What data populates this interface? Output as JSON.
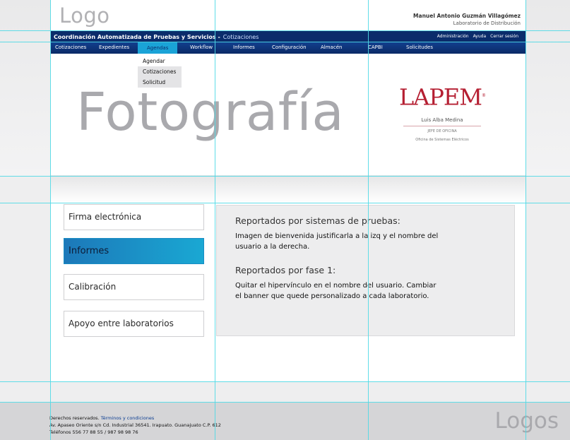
{
  "header": {
    "logo": "Logo",
    "user": {
      "name": "Manuel Antonio Guzmán Villagómez",
      "lab": "Laboratorio de Distribución"
    }
  },
  "titlebar": {
    "app_title": "Coordinación Automatizada de Pruebas y Servicios -",
    "crumb": "Cotizaciones",
    "links": [
      "Administración",
      "Ayuda",
      "Cerrar sesión"
    ]
  },
  "menu": {
    "items": [
      "Cotizaciones",
      "Expedientes",
      "Agendas",
      "Workflow",
      "Informes",
      "Configuración",
      "Almacén",
      "CAPBI",
      "Solicitudes"
    ],
    "active": "Agendas"
  },
  "dropdown": {
    "items": [
      "Agendar",
      "Cotizaciones",
      "Solicitud"
    ]
  },
  "banner": {
    "photo_placeholder": "Fotografía",
    "card": {
      "logo": "LAPEM",
      "name": "Luis Alba Medina",
      "role": "JEFE DE OFICINA",
      "office": "Oficina de Sistemas Eléctricos"
    }
  },
  "sidebar": {
    "items": [
      "Firma electrónica",
      "Informes",
      "Calibración",
      "Apoyo entre laboratorios"
    ],
    "active": "Informes"
  },
  "content": {
    "section1": {
      "title": "Reportados por sistemas de pruebas:",
      "body": "Imagen de bienvenida justificarla a la izq y el nombre del usuario a la derecha."
    },
    "section2": {
      "title": "Reportados por fase 1:",
      "body": "Quitar el hipervínculo en el nombre del usuario. Cambiar el banner que quede personalizado a cada laboratorio."
    }
  },
  "footer": {
    "rights": "Derechos reservados.",
    "terms": "Términos y condiciones",
    "address": "Av. Apaseo Oriente s/n Cd. Industrial 36541. Irapuato. Guanajuato  C.P. 612",
    "phones": "Teléfonos 556 77 88 55 / 987 98 98 76",
    "logos": "Logos"
  },
  "colors": {
    "navy": "#0b2c6b",
    "accent": "#1aa3d7",
    "lapem_red": "#b51f32",
    "guide": "#4fd9e6"
  }
}
